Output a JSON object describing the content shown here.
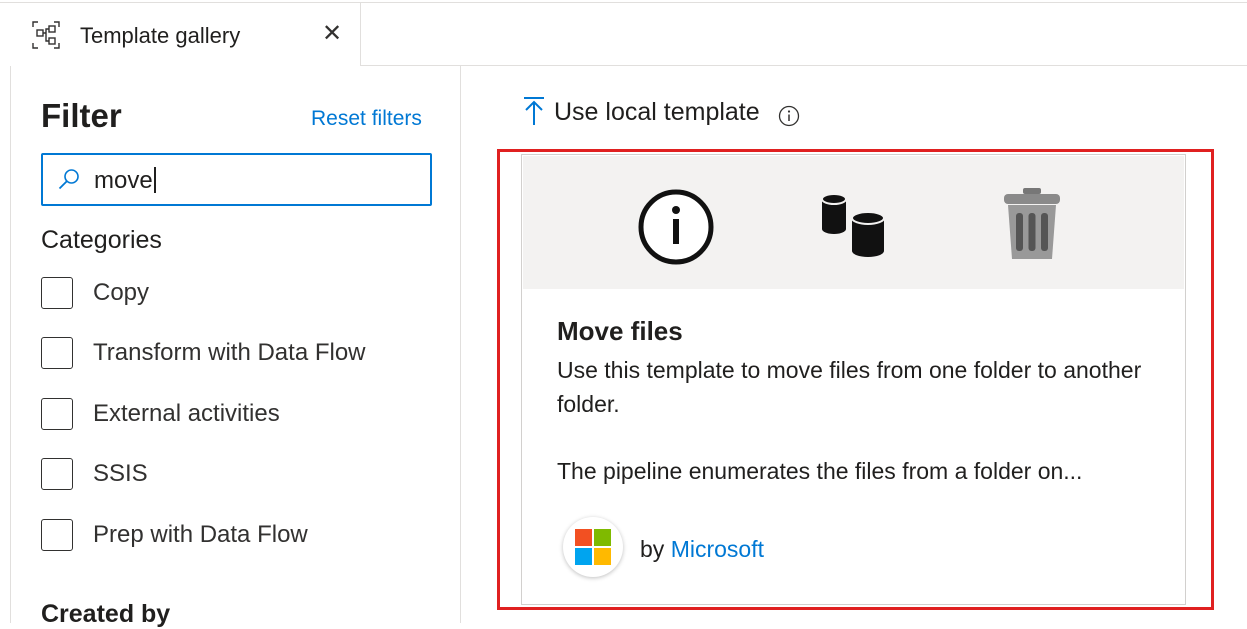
{
  "tab": {
    "title": "Template gallery",
    "close_glyph": "✕",
    "icon": "pipeline-template-icon"
  },
  "filter": {
    "title": "Filter",
    "reset_label": "Reset filters",
    "search": {
      "value": "move",
      "placeholder": "",
      "icon": "search-icon"
    },
    "categories_title": "Categories",
    "categories": [
      {
        "label": "Copy",
        "checked": false
      },
      {
        "label": "Transform with Data Flow",
        "checked": false
      },
      {
        "label": "External activities",
        "checked": false
      },
      {
        "label": "SSIS",
        "checked": false
      },
      {
        "label": "Prep with Data Flow",
        "checked": false
      }
    ],
    "created_by_title": "Created by"
  },
  "main": {
    "use_local_label": "Use local template",
    "template_card": {
      "title": "Move files",
      "description": "Use this template to move files from one folder to another folder.",
      "description_2": "The pipeline enumerates the files from a folder on...",
      "by_prefix": "by",
      "publisher": "Microsoft",
      "activity_icons": [
        "info-icon",
        "database-icon",
        "trash-icon"
      ]
    }
  },
  "colors": {
    "accent": "#0078d4",
    "highlight_border": "#e02020",
    "card_header_bg": "#f3f2f1",
    "ms_red": "#f25022",
    "ms_green": "#7fba00",
    "ms_blue": "#00a4ef",
    "ms_yellow": "#ffb900"
  }
}
